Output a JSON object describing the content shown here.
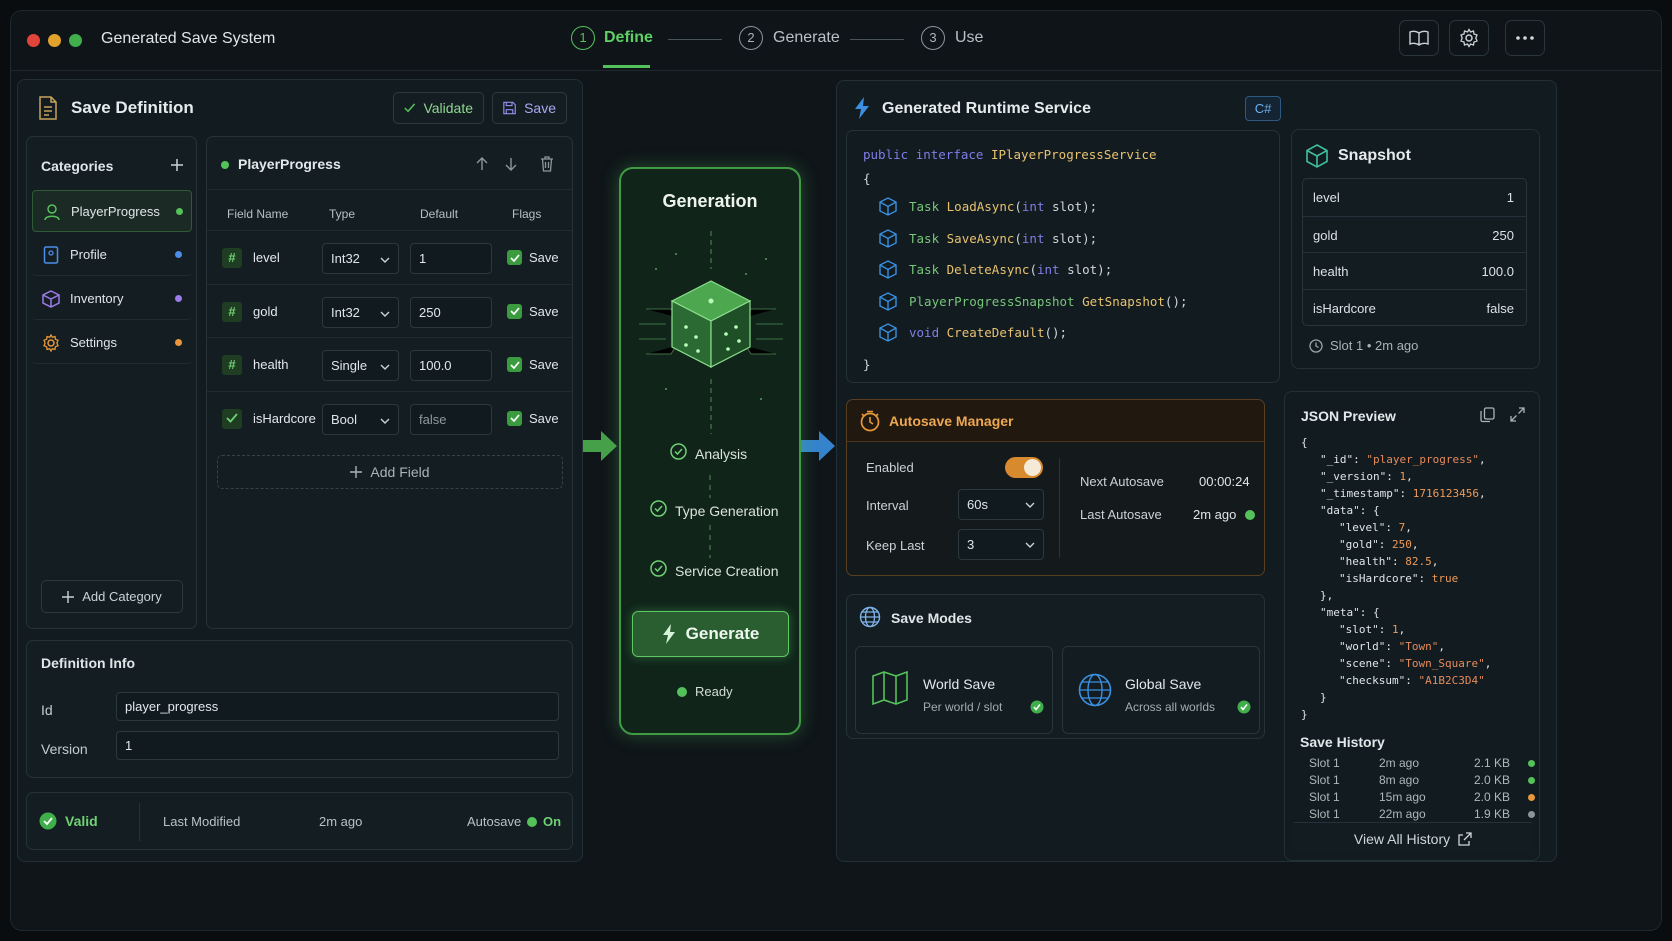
{
  "window": {
    "title": "Generated Save System"
  },
  "steps": [
    {
      "num": "1",
      "label": "Define"
    },
    {
      "num": "2",
      "label": "Generate"
    },
    {
      "num": "3",
      "label": "Use"
    }
  ],
  "definition": {
    "title": "Save Definition",
    "validate_label": "Validate",
    "save_label": "Save",
    "categories_label": "Categories",
    "categories": [
      {
        "name": "PlayerProgress",
        "dot": "#54c25a"
      },
      {
        "name": "Profile",
        "dot": "#4c8de8"
      },
      {
        "name": "Inventory",
        "dot": "#9b7be8"
      },
      {
        "name": "Settings",
        "dot": "#e8973a"
      }
    ],
    "add_category_label": "Add Category",
    "selected": "PlayerProgress",
    "columns": [
      "Field Name",
      "Type",
      "Default",
      "Flags"
    ],
    "fields": [
      {
        "icon": "#",
        "name": "level",
        "type": "Int32",
        "default": "1",
        "flag": "Save"
      },
      {
        "icon": "#",
        "name": "gold",
        "type": "Int32",
        "default": "250",
        "flag": "Save"
      },
      {
        "icon": "#",
        "name": "health",
        "type": "Single",
        "default": "100.0",
        "flag": "Save"
      },
      {
        "icon": "check",
        "name": "isHardcore",
        "type": "Bool",
        "default": "false",
        "flag": "Save"
      }
    ],
    "add_field_label": "Add Field"
  },
  "info": {
    "title": "Definition Info",
    "id_label": "Id",
    "id_value": "player_progress",
    "version_label": "Version",
    "version_value": "1"
  },
  "status": {
    "valid": "Valid",
    "last_modified_label": "Last Modified",
    "last_modified": "2m ago",
    "autosave_label": "Autosave",
    "autosave_value": "On"
  },
  "generation": {
    "title": "Generation",
    "steps": [
      "Analysis",
      "Type Generation",
      "Service Creation"
    ],
    "button": "Generate",
    "status": "Ready"
  },
  "runtime": {
    "title": "Generated Runtime Service",
    "lang": "C#",
    "header": [
      "public",
      "interface",
      "IPlayerProgressService"
    ],
    "open": "{",
    "close": "}",
    "methods": [
      {
        "ret": "Task",
        "name": "LoadAsync",
        "args_kw": "int",
        "args_rest": " slot);"
      },
      {
        "ret": "Task",
        "name": "SaveAsync",
        "args_kw": "int",
        "args_rest": " slot);"
      },
      {
        "ret": "Task",
        "name": "DeleteAsync",
        "args_kw": "int",
        "args_rest": " slot);"
      },
      {
        "ret": "PlayerProgressSnapshot",
        "name": "GetSnapshot",
        "args_kw": "",
        "args_rest": ");"
      },
      {
        "ret": "void",
        "name": "CreateDefault",
        "args_kw": "",
        "args_rest": ");"
      }
    ]
  },
  "snapshot": {
    "title": "Snapshot",
    "rows": [
      {
        "k": "level",
        "v": "1"
      },
      {
        "k": "gold",
        "v": "250"
      },
      {
        "k": "health",
        "v": "100.0"
      },
      {
        "k": "isHardcore",
        "v": "false"
      }
    ],
    "footer": "Slot 1 • 2m ago"
  },
  "autosave": {
    "title": "Autosave Manager",
    "enabled_label": "Enabled",
    "interval_label": "Interval",
    "interval_value": "60s",
    "keep_label": "Keep Last",
    "keep_value": "3",
    "next_label": "Next Autosave",
    "next_value": "00:00:24",
    "last_label": "Last Autosave",
    "last_value": "2m ago"
  },
  "modes": {
    "title": "Save Modes",
    "items": [
      {
        "name": "World Save",
        "desc": "Per world / slot"
      },
      {
        "name": "Global Save",
        "desc": "Across all worlds"
      }
    ]
  },
  "json_preview": {
    "title": "JSON Preview",
    "lines": [
      [
        [
          "{",
          "jk"
        ]
      ],
      [
        [
          "\"_id\"",
          "jk"
        ],
        [
          ": ",
          "jk"
        ],
        [
          "\"player_progress\"",
          "js"
        ],
        [
          ",",
          "jk"
        ]
      ],
      [
        [
          "\"_version\"",
          "jk"
        ],
        [
          ": ",
          "jk"
        ],
        [
          "1",
          "jn"
        ],
        [
          ",",
          "jk"
        ]
      ],
      [
        [
          "\"_timestamp\"",
          "jk"
        ],
        [
          ": ",
          "jk"
        ],
        [
          "1716123456",
          "jn"
        ],
        [
          ",",
          "jk"
        ]
      ],
      [
        [
          "\"data\"",
          "jk"
        ],
        [
          ": {",
          "jk"
        ]
      ],
      [
        [
          "\"level\"",
          "jk"
        ],
        [
          ": ",
          "jk"
        ],
        [
          "7",
          "jn"
        ],
        [
          ",",
          "jk"
        ]
      ],
      [
        [
          "\"gold\"",
          "jk"
        ],
        [
          ": ",
          "jk"
        ],
        [
          "250",
          "jn"
        ],
        [
          ",",
          "jk"
        ]
      ],
      [
        [
          "\"health\"",
          "jk"
        ],
        [
          ": ",
          "jk"
        ],
        [
          "82.5",
          "jn"
        ],
        [
          ",",
          "jk"
        ]
      ],
      [
        [
          "\"isHardcore\"",
          "jk"
        ],
        [
          ": ",
          "jk"
        ],
        [
          "true",
          "jn"
        ]
      ],
      [
        [
          "},",
          "jk"
        ]
      ],
      [
        [
          "\"meta\"",
          "jk"
        ],
        [
          ": {",
          "jk"
        ]
      ],
      [
        [
          "\"slot\"",
          "jk"
        ],
        [
          ": ",
          "jk"
        ],
        [
          "1",
          "jn"
        ],
        [
          ",",
          "jk"
        ]
      ],
      [
        [
          "\"world\"",
          "jk"
        ],
        [
          ": ",
          "jk"
        ],
        [
          "\"Town\"",
          "js"
        ],
        [
          ",",
          "jk"
        ]
      ],
      [
        [
          "\"scene\"",
          "jk"
        ],
        [
          ": ",
          "jk"
        ],
        [
          "\"Town_Square\"",
          "js"
        ],
        [
          ",",
          "jk"
        ]
      ],
      [
        [
          "\"checksum\"",
          "jk"
        ],
        [
          ": ",
          "jk"
        ],
        [
          "\"A1B2C3D4\"",
          "js"
        ]
      ],
      [
        [
          "}",
          "jk"
        ]
      ],
      [
        [
          "}",
          "jk"
        ]
      ]
    ]
  },
  "history": {
    "title": "Save History",
    "rows": [
      {
        "slot": "Slot 1",
        "time": "2m ago",
        "size": "2.1 KB",
        "dot": "#54c25a"
      },
      {
        "slot": "Slot 1",
        "time": "8m ago",
        "size": "2.0 KB",
        "dot": "#54c25a"
      },
      {
        "slot": "Slot 1",
        "time": "15m ago",
        "size": "2.0 KB",
        "dot": "#e8973a"
      },
      {
        "slot": "Slot 1",
        "time": "22m ago",
        "size": "1.9 KB",
        "dot": "#8a9499"
      }
    ],
    "view_all": "View All History"
  },
  "colors": {
    "accent": "#54c25a",
    "blue": "#3aa0e8",
    "orange": "#e8973a"
  }
}
